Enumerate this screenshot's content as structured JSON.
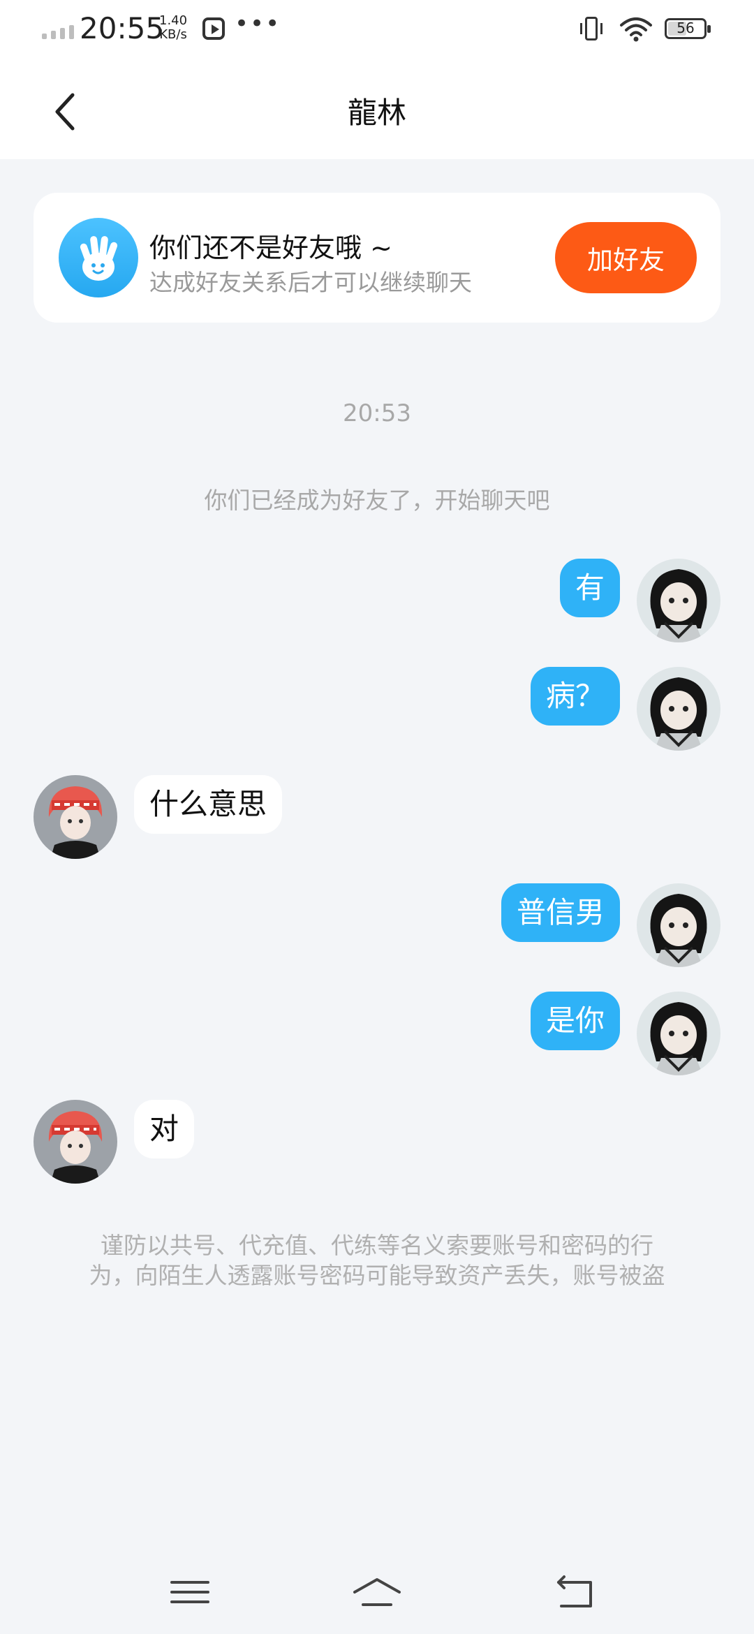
{
  "status_bar": {
    "time": "20:55",
    "speed_value": "1.40",
    "speed_unit": "KB/s",
    "more": "•••",
    "battery": "56"
  },
  "header": {
    "title": "龍林"
  },
  "friend_card": {
    "title": "你们还不是好友哦 ~",
    "subtitle": "达成好友关系后才可以继续聊天",
    "button": "加好友"
  },
  "chat": {
    "timestamp": "20:53",
    "system_message": "你们已经成为好友了，开始聊天吧",
    "messages": [
      {
        "from": "me",
        "text": "有"
      },
      {
        "from": "me",
        "text": "病？"
      },
      {
        "from": "other",
        "text": "什么意思"
      },
      {
        "from": "me",
        "text": "普信男"
      },
      {
        "from": "me",
        "text": "是你"
      },
      {
        "from": "other",
        "text": "对"
      }
    ],
    "warning_line1": "谨防以共号、代充值、代练等名义索要账号和密码的行",
    "warning_line2": "为，向陌生人透露账号密码可能导致资产丢失，账号被盗"
  },
  "colors": {
    "accent_blue": "#2fb2f7",
    "add_button": "#fd5a15",
    "background": "#f3f5f8"
  },
  "icons": {
    "back": "chevron-left-icon",
    "card": "hand-wave-icon",
    "nav_menu": "menu-icon",
    "nav_home": "home-icon",
    "nav_back": "return-icon"
  }
}
